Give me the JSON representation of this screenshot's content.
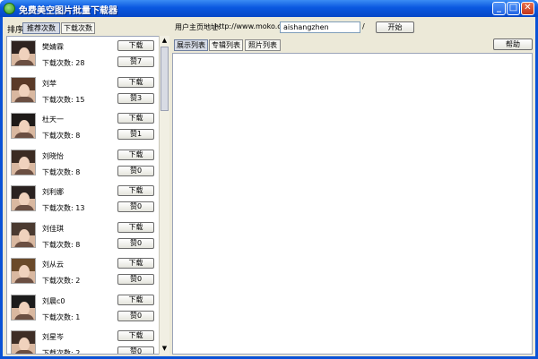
{
  "window": {
    "title": "免费美空图片批量下载器",
    "minimize_glyph": "_",
    "maximize_glyph": "□",
    "close_glyph": "✕"
  },
  "sort": {
    "label": "排序",
    "tabs": [
      "推荐次数",
      "下载次数"
    ],
    "active_tab": "推荐次数"
  },
  "users": [
    {
      "name": "樊婧霖",
      "count_label": "下载次数: 28",
      "download_label": "下载",
      "like_label": "赞7"
    },
    {
      "name": "刘苹",
      "count_label": "下载次数: 15",
      "download_label": "下载",
      "like_label": "赞3"
    },
    {
      "name": "杜天一",
      "count_label": "下载次数: 8",
      "download_label": "下载",
      "like_label": "赞1"
    },
    {
      "name": "刘晓怡",
      "count_label": "下载次数: 8",
      "download_label": "下载",
      "like_label": "赞0"
    },
    {
      "name": "刘利娜",
      "count_label": "下载次数: 13",
      "download_label": "下载",
      "like_label": "赞0"
    },
    {
      "name": "刘佳琪",
      "count_label": "下载次数: 8",
      "download_label": "下载",
      "like_label": "赞0"
    },
    {
      "name": "刘从云",
      "count_label": "下载次数: 2",
      "download_label": "下载",
      "like_label": "赞0"
    },
    {
      "name": "刘晨c0",
      "count_label": "下载次数: 1",
      "download_label": "下载",
      "like_label": "赞0"
    },
    {
      "name": "刘星岑",
      "count_label": "下载次数: 2",
      "download_label": "下载",
      "like_label": "赞0"
    }
  ],
  "homepage": {
    "label": "用户主页地址:",
    "url_prefix": "http://www.moko.cc/",
    "username_value": "aishangzhen",
    "suffix": "/",
    "start_label": "开始"
  },
  "view_tabs": [
    "展示列表",
    "专辑列表",
    "照片列表"
  ],
  "active_view_tab": "展示列表",
  "help_label": "帮助",
  "colors": {
    "titlebar": "#0a58e0",
    "window_bg": "#ece9d8"
  }
}
